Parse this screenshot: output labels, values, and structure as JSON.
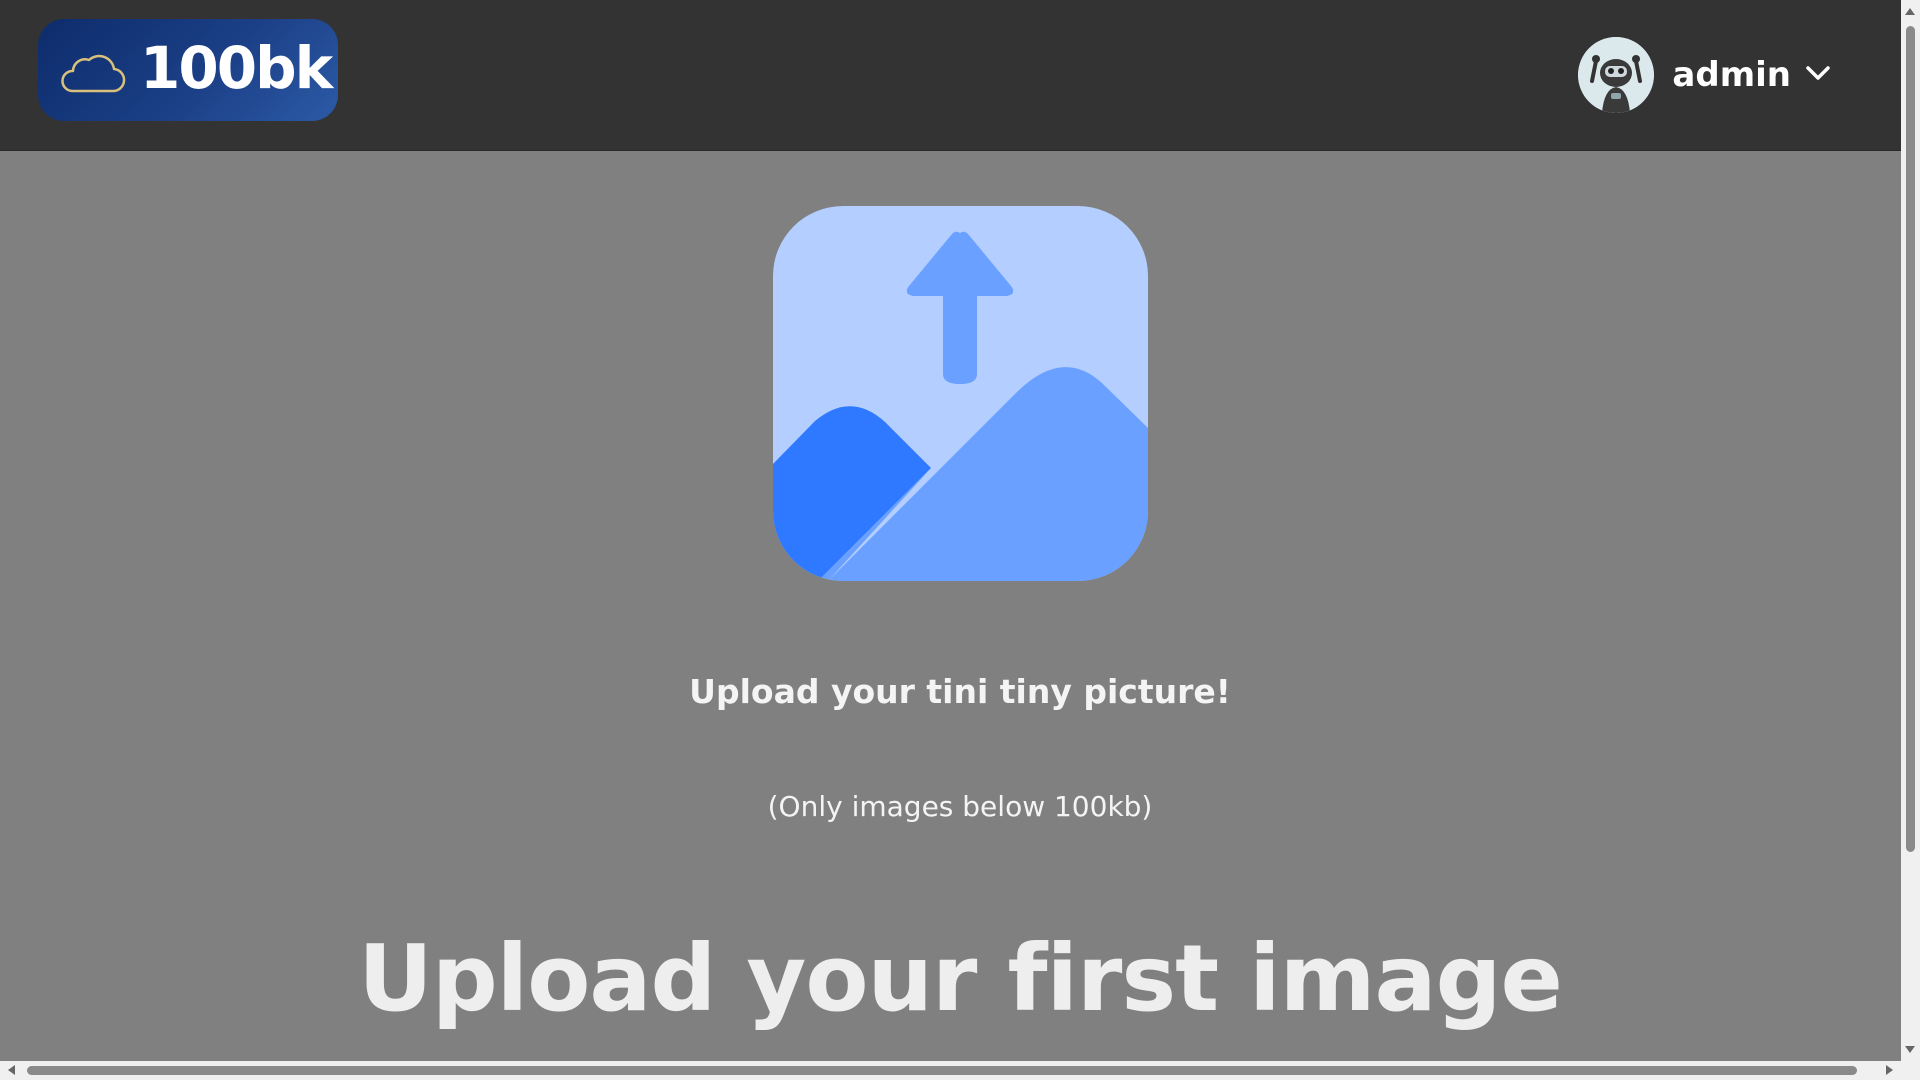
{
  "header": {
    "brand": "100bk",
    "logo_icon": "cloud-icon",
    "user": {
      "name": "admin",
      "avatar_icon": "robot-avatar-icon",
      "dropdown_icon": "chevron-down-icon"
    }
  },
  "main": {
    "upload_icon": "image-upload-icon",
    "prompt": "Upload your tini tiny picture!",
    "note": "(Only images below 100kb)",
    "headline": "Upload your first image"
  },
  "colors": {
    "header_bg": "#333333",
    "page_bg": "#808080",
    "logo_gradient_start": "#0d2c6b",
    "logo_gradient_end": "#2c5aa6",
    "icon_light": "#b3ceff",
    "icon_mid": "#6aa0ff",
    "icon_dark": "#2e79ff"
  }
}
